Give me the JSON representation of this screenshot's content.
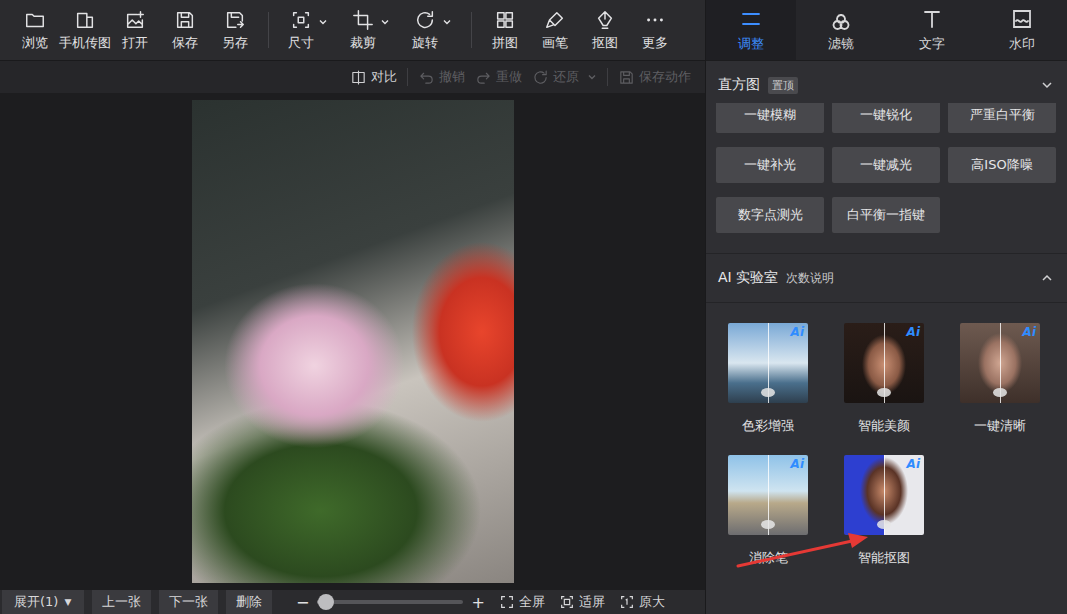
{
  "toolbar": {
    "groups": [
      [
        {
          "label": "浏览",
          "dropdown": false
        },
        {
          "label": "手机传图",
          "dropdown": false
        },
        {
          "label": "打开",
          "dropdown": false
        },
        {
          "label": "保存",
          "dropdown": false
        },
        {
          "label": "另存",
          "dropdown": false
        }
      ],
      [
        {
          "label": "尺寸",
          "dropdown": true
        },
        {
          "label": "裁剪",
          "dropdown": true
        },
        {
          "label": "旋转",
          "dropdown": true
        }
      ],
      [
        {
          "label": "拼图",
          "dropdown": false
        },
        {
          "label": "画笔",
          "dropdown": false
        },
        {
          "label": "抠图",
          "dropdown": false
        },
        {
          "label": "更多",
          "dropdown": false
        }
      ]
    ]
  },
  "actions": [
    {
      "label": "对比",
      "disabled": false,
      "dropdown": false
    },
    {
      "label": "撤销",
      "disabled": true,
      "dropdown": false
    },
    {
      "label": "重做",
      "disabled": true,
      "dropdown": false
    },
    {
      "label": "还原",
      "disabled": true,
      "dropdown": true
    },
    {
      "label": "保存动作",
      "disabled": true,
      "dropdown": false
    }
  ],
  "bottom_bar": {
    "view_select": {
      "label": "展开(1)",
      "arrow": "▼"
    },
    "buttons": [
      "上一张",
      "下一张",
      "删除"
    ],
    "zoom": {
      "minus": "−",
      "plus": "+",
      "level": 0.06
    },
    "view_buttons": [
      "全屏",
      "适屏",
      "原大"
    ]
  },
  "panel": {
    "tabs": [
      {
        "label": "调整",
        "selected": true
      },
      {
        "label": "滤镜",
        "selected": false
      },
      {
        "label": "文字",
        "selected": false
      },
      {
        "label": "水印",
        "selected": false
      }
    ],
    "histogram": {
      "title": "直方图",
      "badge": "置顶",
      "expanded": false
    },
    "quick_buttons": [
      "一键模糊",
      "一键锐化",
      "严重白平衡",
      "一键补光",
      "一键减光",
      "高ISO降噪",
      "数字点测光",
      "白平衡一指键"
    ],
    "ai_lab": {
      "title": "AI 实验室",
      "link": "次数说明",
      "expanded": true,
      "tools": [
        {
          "label": "色彩增强",
          "badge": "Ai"
        },
        {
          "label": "智能美颜",
          "badge": "Ai"
        },
        {
          "label": "一键清晰",
          "badge": "Ai"
        },
        {
          "label": "消除笔",
          "badge": "Ai"
        },
        {
          "label": "智能抠图",
          "badge": "Ai"
        }
      ]
    }
  }
}
